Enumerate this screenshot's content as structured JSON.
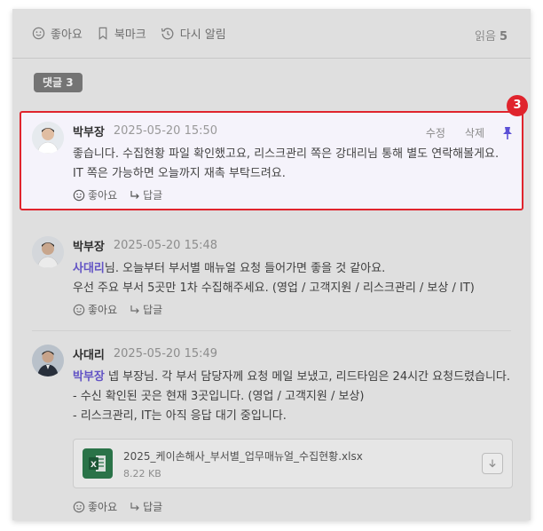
{
  "action_bar": {
    "like_label": "좋아요",
    "bookmark_label": "북마크",
    "remind_label": "다시 알림",
    "read_label": "읽음",
    "read_count": "5"
  },
  "comments_badge": "댓글 3",
  "pinned_marker": "3",
  "comments": [
    {
      "author": "박부장",
      "time": "2025-05-20 15:50",
      "line1": "좋습니다. 수집현황 파일 확인했고요, 리스크관리 쪽은 강대리님 통해 별도 연락해볼게요.",
      "line2": "IT 쪽은 가능하면 오늘까지 재촉 부탁드려요.",
      "edit_label": "수정",
      "delete_label": "삭제",
      "like_label": "좋아요",
      "reply_label": "답글"
    },
    {
      "author": "박부장",
      "time": "2025-05-20 15:48",
      "mention": "사대리",
      "line1_rest": "님. 오늘부터 부서별 매뉴얼 요청 들어가면 좋을 것 같아요.",
      "line2": "우선 주요 부서 5곳만 1차 수집해주세요. (영업 / 고객지원 / 리스크관리 / 보상 / IT)",
      "like_label": "좋아요",
      "reply_label": "답글"
    },
    {
      "author": "사대리",
      "time": "2025-05-20 15:49",
      "mention": "박부장",
      "line1_rest": " 넵 부장님. 각 부서 담당자께 요청 메일 보냈고, 리드타임은 24시간 요청드렸습니다.",
      "line2": "- 수신 확인된 곳은 현재 3곳입니다. (영업 / 고객지원 / 보상)",
      "line3": "- 리스크관리, IT는 아직 응답 대기 중입니다.",
      "attachment": {
        "name": "2025_케이손해사_부서별_업무매뉴얼_수집현황.xlsx",
        "size": "8.22 KB"
      },
      "like_label": "좋아요",
      "reply_label": "답글"
    }
  ],
  "colors": {
    "highlight_border": "#e0242d",
    "mention": "#6b5bd6",
    "pin": "#5b4fd6",
    "excel_green": "#2e7d4f"
  }
}
